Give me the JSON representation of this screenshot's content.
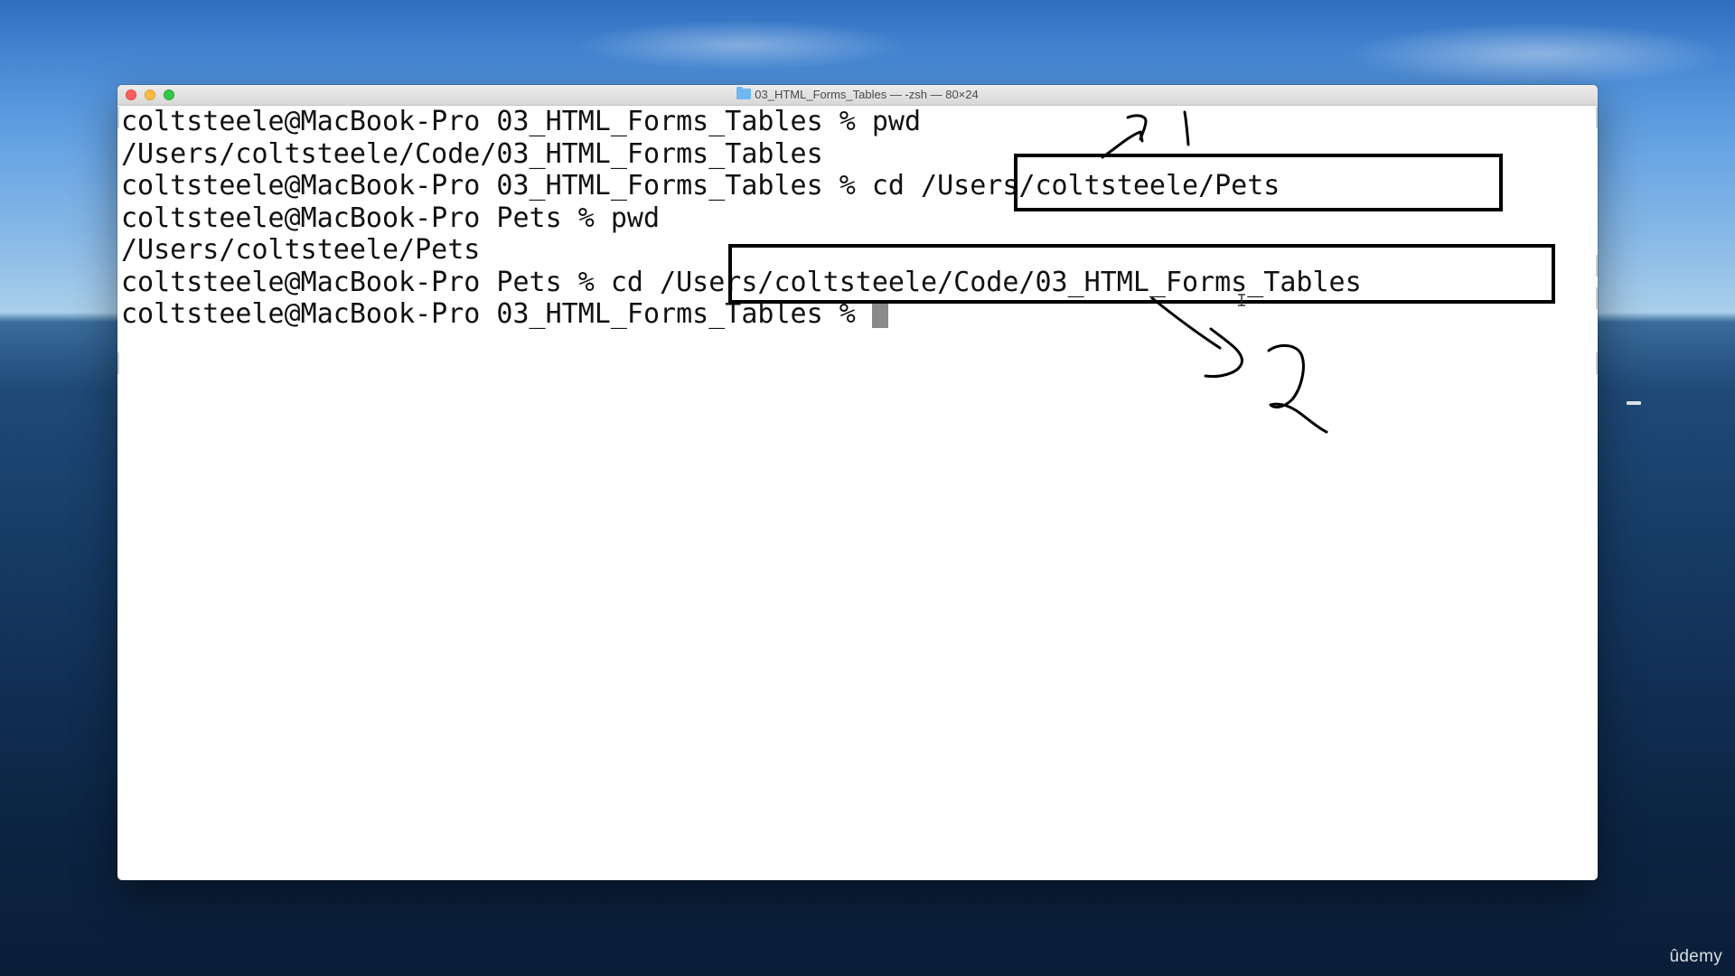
{
  "window": {
    "title": "03_HTML_Forms_Tables — -zsh — 80×24",
    "folder_icon": "folder-icon"
  },
  "terminal": {
    "lines": [
      {
        "text": "coltsteele@MacBook-Pro 03_HTML_Forms_Tables % pwd"
      },
      {
        "text": "/Users/coltsteele/Code/03_HTML_Forms_Tables"
      },
      {
        "text": "coltsteele@MacBook-Pro 03_HTML_Forms_Tables % cd /Users/coltsteele/Pets"
      },
      {
        "text": "coltsteele@MacBook-Pro Pets % pwd"
      },
      {
        "text": "/Users/coltsteele/Pets"
      },
      {
        "text": "coltsteele@MacBook-Pro Pets % cd /Users/coltsteele/Code/03_HTML_Forms_Tables"
      },
      {
        "text": "coltsteele@MacBook-Pro 03_HTML_Forms_Tables % "
      }
    ],
    "cursor_color": "#8a8a8a"
  },
  "annotations": {
    "label_1": "1",
    "label_2": "2",
    "stroke_color": "#000000"
  },
  "watermark": {
    "text": "ûdemy"
  }
}
